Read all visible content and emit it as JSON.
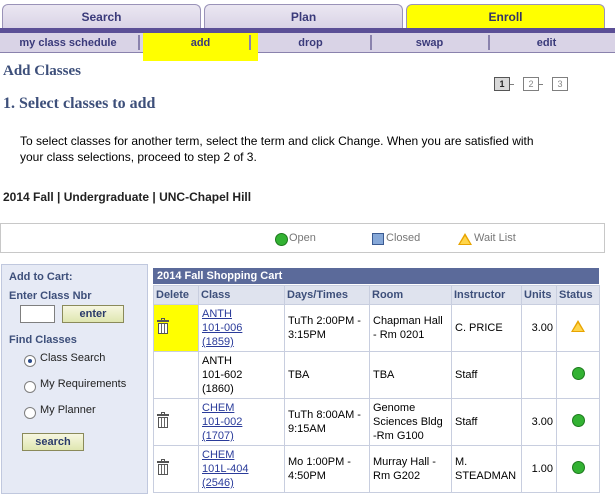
{
  "top_tabs": [
    {
      "label": "Search",
      "active": false
    },
    {
      "label": "Plan",
      "active": false
    },
    {
      "label": "Enroll",
      "active": true
    }
  ],
  "sub_tabs": [
    {
      "label": "my class schedule",
      "active": false
    },
    {
      "label": "add",
      "active": true
    },
    {
      "label": "drop",
      "active": false
    },
    {
      "label": "swap",
      "active": false
    },
    {
      "label": "edit",
      "active": false
    }
  ],
  "page_title": "Add Classes",
  "steps": [
    "1",
    "2",
    "3"
  ],
  "current_step": 1,
  "step_heading": "1.  Select classes to add",
  "instructions": "To select classes for another term, select the term and click Change.  When you are satisfied with your class selections, proceed to step 2 of 3.",
  "term": "2014 Fall | Undergraduate | UNC-Chapel Hill",
  "legend": {
    "open": "Open",
    "closed": "Closed",
    "waitlist": "Wait List"
  },
  "left_panel": {
    "add_to_cart": "Add to Cart:",
    "enter_class_nbr": "Enter Class Nbr",
    "enter_button": "enter",
    "find_classes": "Find Classes",
    "options": [
      {
        "label": "Class Search",
        "selected": true
      },
      {
        "label": "My Requirements",
        "selected": false
      },
      {
        "label": "My Planner",
        "selected": false
      }
    ],
    "search_button": "search"
  },
  "cart": {
    "title": "2014 Fall Shopping Cart",
    "headers": [
      "Delete",
      "Class",
      "Days/Times",
      "Room",
      "Instructor",
      "Units",
      "Status"
    ],
    "rows": [
      {
        "delete": true,
        "class_code": "ANTH",
        "class_section": "101-006",
        "class_nbr": "(1859)",
        "link": true,
        "days_times": "TuTh 2:00PM - 3:15PM",
        "room": "Chapman Hall - Rm 0201",
        "instructor": "C. PRICE",
        "units": "3.00",
        "status": "waitlist",
        "highlight": true
      },
      {
        "delete": false,
        "class_code": "ANTH",
        "class_section": "101-602",
        "class_nbr": "(1860)",
        "link": false,
        "days_times": "TBA",
        "room": "TBA",
        "instructor": "Staff",
        "units": "",
        "status": "open",
        "highlight": false
      },
      {
        "delete": true,
        "class_code": "CHEM",
        "class_section": "101-002",
        "class_nbr": "(1707)",
        "link": true,
        "days_times": "TuTh 8:00AM - 9:15AM",
        "room": "Genome Sciences Bldg -Rm G100",
        "instructor": "Staff",
        "units": "3.00",
        "status": "open",
        "highlight": false
      },
      {
        "delete": true,
        "class_code": "CHEM",
        "class_section": "101L-404",
        "class_nbr": "(2546)",
        "link": true,
        "days_times": "Mo 1:00PM - 4:50PM",
        "room": "Murray Hall - Rm G202",
        "instructor": "M. STEADMAN",
        "units": "1.00",
        "status": "open",
        "highlight": false
      }
    ]
  }
}
